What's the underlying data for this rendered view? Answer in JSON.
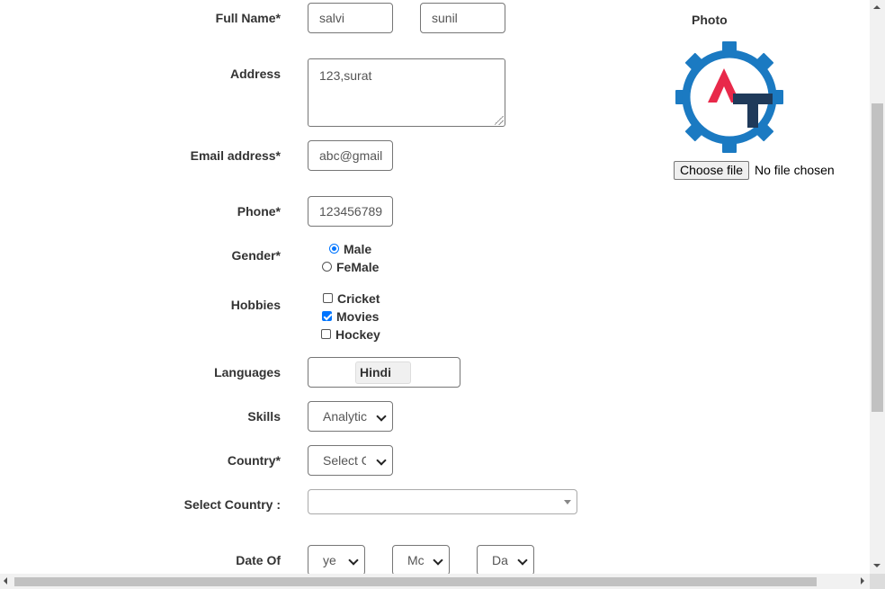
{
  "form": {
    "full_name": {
      "label": "Full Name*",
      "first": "salvi",
      "last": "sunil"
    },
    "address": {
      "label": "Address",
      "value": "123,surat"
    },
    "email": {
      "label": "Email address*",
      "value": "abc@gmail"
    },
    "phone": {
      "label": "Phone*",
      "value": "123456789"
    },
    "gender": {
      "label": "Gender*",
      "options": [
        {
          "label": "Male",
          "checked": true
        },
        {
          "label": "FeMale",
          "checked": false
        }
      ]
    },
    "hobbies": {
      "label": "Hobbies",
      "options": [
        {
          "label": "Cricket",
          "checked": false
        },
        {
          "label": "Movies",
          "checked": true
        },
        {
          "label": "Hockey",
          "checked": false
        }
      ]
    },
    "languages": {
      "label": "Languages",
      "selected": [
        "Hindi"
      ]
    },
    "skills": {
      "label": "Skills",
      "value": "Analytic"
    },
    "country": {
      "label": "Country*",
      "value": "Select C"
    },
    "select_country": {
      "label": "Select Country :",
      "value": ""
    },
    "dob": {
      "label": "Date Of",
      "year": "ye",
      "month": "Mc",
      "day": "Da"
    }
  },
  "photo": {
    "label": "Photo",
    "logo_icon": "gear-logo-AT",
    "choose_button": "Choose file",
    "status": "No file chosen"
  },
  "colors": {
    "accent": "#0075ff",
    "logo_blue": "#1b7ac2",
    "logo_red": "#e8294a",
    "logo_navy": "#1f3a5a"
  }
}
